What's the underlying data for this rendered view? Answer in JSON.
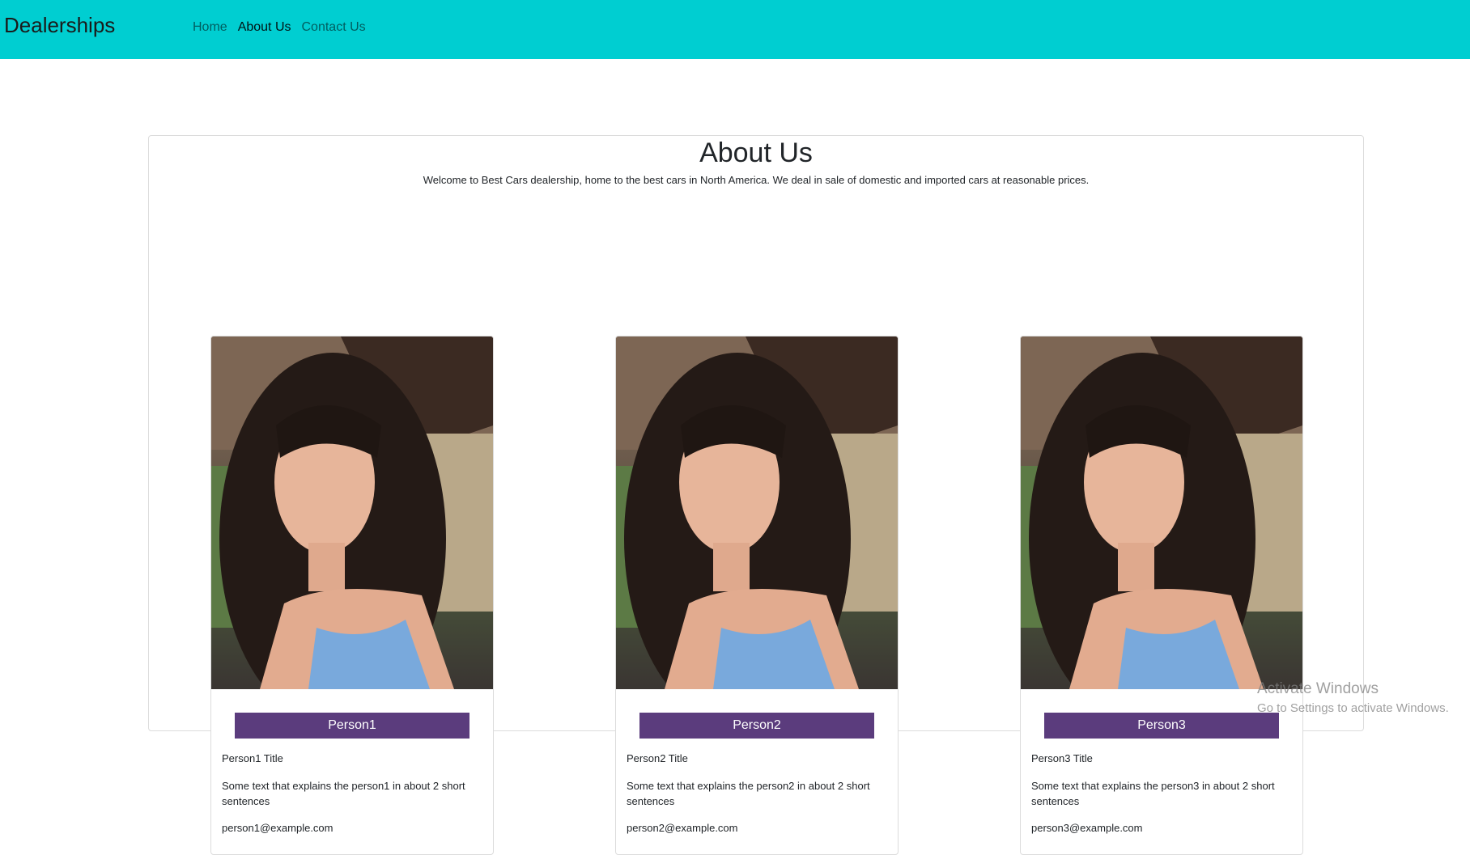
{
  "navbar": {
    "brand": "Dealerships",
    "links": [
      "Home",
      "About Us",
      "Contact Us"
    ],
    "active": "About Us",
    "color": "#00ced1"
  },
  "about": {
    "title": "About Us",
    "intro": "Welcome to Best Cars dealership, home to the best cars in North America. We deal in sale of domestic and imported cars at reasonable prices."
  },
  "people": [
    {
      "name": "Person1",
      "title": "Person1 Title",
      "description": "Some text that explains the person1 in about 2 short sentences",
      "email": "person1@example.com"
    },
    {
      "name": "Person2",
      "title": "Person2 Title",
      "description": "Some text that explains the person2 in about 2 short sentences",
      "email": "person2@example.com"
    },
    {
      "name": "Person3",
      "title": "Person3 Title",
      "description": "Some text that explains the person3 in about 2 short sentences",
      "email": "person3@example.com"
    }
  ],
  "name_bar_color": "#5b3c7d",
  "watermark": {
    "title": "Activate Windows",
    "subtitle": "Go to Settings to activate Windows."
  }
}
